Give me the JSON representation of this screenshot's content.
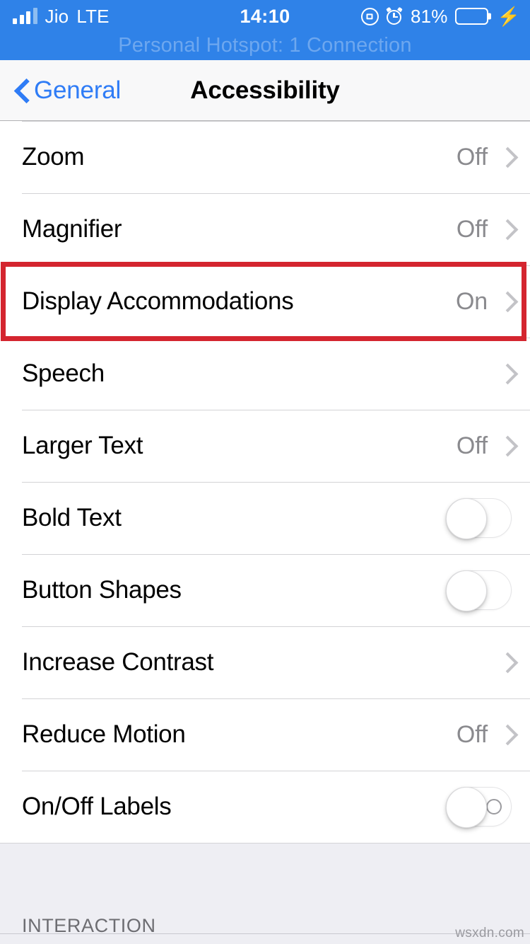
{
  "status_bar": {
    "carrier": "Jio",
    "network_type": "LTE",
    "time": "14:10",
    "battery_percent": "81%",
    "icons": {
      "signal": "signal-bars-icon",
      "rotation_lock": "rotation-lock-icon",
      "alarm": "alarm-clock-icon",
      "battery": "battery-icon",
      "charging": "charging-bolt-icon"
    },
    "hotspot_banner": "Personal Hotspot: 1 Connection",
    "background_color": "#2f82e8"
  },
  "nav_bar": {
    "back_label": "General",
    "title": "Accessibility",
    "tint_color": "#2f7cf6"
  },
  "list": {
    "rows": [
      {
        "label": "Zoom",
        "value": "Off",
        "accessory": "chevron"
      },
      {
        "label": "Magnifier",
        "value": "Off",
        "accessory": "chevron"
      },
      {
        "label": "Display Accommodations",
        "value": "On",
        "accessory": "chevron",
        "highlighted": true
      },
      {
        "label": "Speech",
        "value": "",
        "accessory": "chevron"
      },
      {
        "label": "Larger Text",
        "value": "Off",
        "accessory": "chevron"
      },
      {
        "label": "Bold Text",
        "value": "",
        "accessory": "toggle",
        "toggle_on": false
      },
      {
        "label": "Button Shapes",
        "value": "",
        "accessory": "toggle",
        "toggle_on": false
      },
      {
        "label": "Increase Contrast",
        "value": "",
        "accessory": "chevron"
      },
      {
        "label": "Reduce Motion",
        "value": "Off",
        "accessory": "chevron"
      },
      {
        "label": "On/Off Labels",
        "value": "",
        "accessory": "toggle-labels",
        "toggle_on": false
      }
    ]
  },
  "next_section": {
    "header": "INTERACTION"
  },
  "highlight": {
    "color": "#d4252f",
    "target_row": "Display Accommodations"
  },
  "watermark": {
    "text": "wsxdn.com"
  }
}
